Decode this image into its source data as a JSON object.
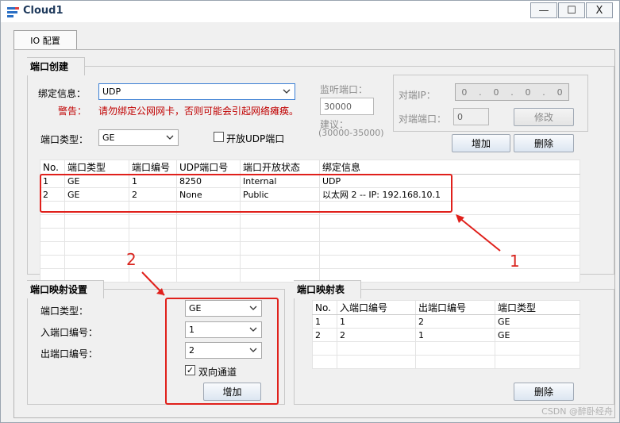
{
  "window": {
    "title": "Cloud1",
    "minimize": "—",
    "maximize": "☐",
    "close": "X"
  },
  "tabs": [
    {
      "label": "IO 配置"
    }
  ],
  "port_creation": {
    "title": "端口创建",
    "bind_info_label": "绑定信息：",
    "bind_info_value": "UDP",
    "warning_label": "警告：",
    "warning_text": "请勿绑定公网网卡，否则可能会引起网络瘫痪。",
    "port_type_label": "端口类型：",
    "port_type_value": "GE",
    "open_udp_label": "开放UDP端口",
    "listen_port_label": "监听端口：",
    "listen_port_value": "30000",
    "suggest_label": "建议：",
    "suggest_range": "(30000-35000)",
    "peer_ip_label": "对端IP：",
    "peer_ip": [
      "0",
      "0",
      "0",
      "0"
    ],
    "peer_port_label": "对端端口：",
    "peer_port_value": "0",
    "modify_button": "修改",
    "add_button": "增加",
    "delete_button": "删除",
    "table": {
      "headers": [
        "No.",
        "端口类型",
        "端口编号",
        "UDP端口号",
        "端口开放状态",
        "绑定信息"
      ],
      "rows": [
        [
          "1",
          "GE",
          "1",
          "8250",
          "Internal",
          "UDP"
        ],
        [
          "2",
          "GE",
          "2",
          "None",
          "Public",
          "以太网 2 -- IP: 192.168.10.1"
        ]
      ]
    }
  },
  "port_mapping": {
    "title": "端口映射设置",
    "port_type_label": "端口类型：",
    "port_type_value": "GE",
    "in_port_label": "入端口编号：",
    "in_port_value": "1",
    "out_port_label": "出端口编号：",
    "out_port_value": "2",
    "bidirectional_label": "双向通道",
    "bidirectional_checked": "✓",
    "add_button": "增加"
  },
  "mapping_table": {
    "title": "端口映射表",
    "headers": [
      "No.",
      "入端口编号",
      "出端口编号",
      "端口类型"
    ],
    "rows": [
      [
        "1",
        "1",
        "2",
        "GE"
      ],
      [
        "2",
        "2",
        "1",
        "GE"
      ]
    ],
    "delete_button": "删除"
  },
  "annotations": {
    "label1": "1",
    "label2": "2",
    "color": "#e0201b"
  },
  "watermark": "CSDN @醉卧经舟"
}
